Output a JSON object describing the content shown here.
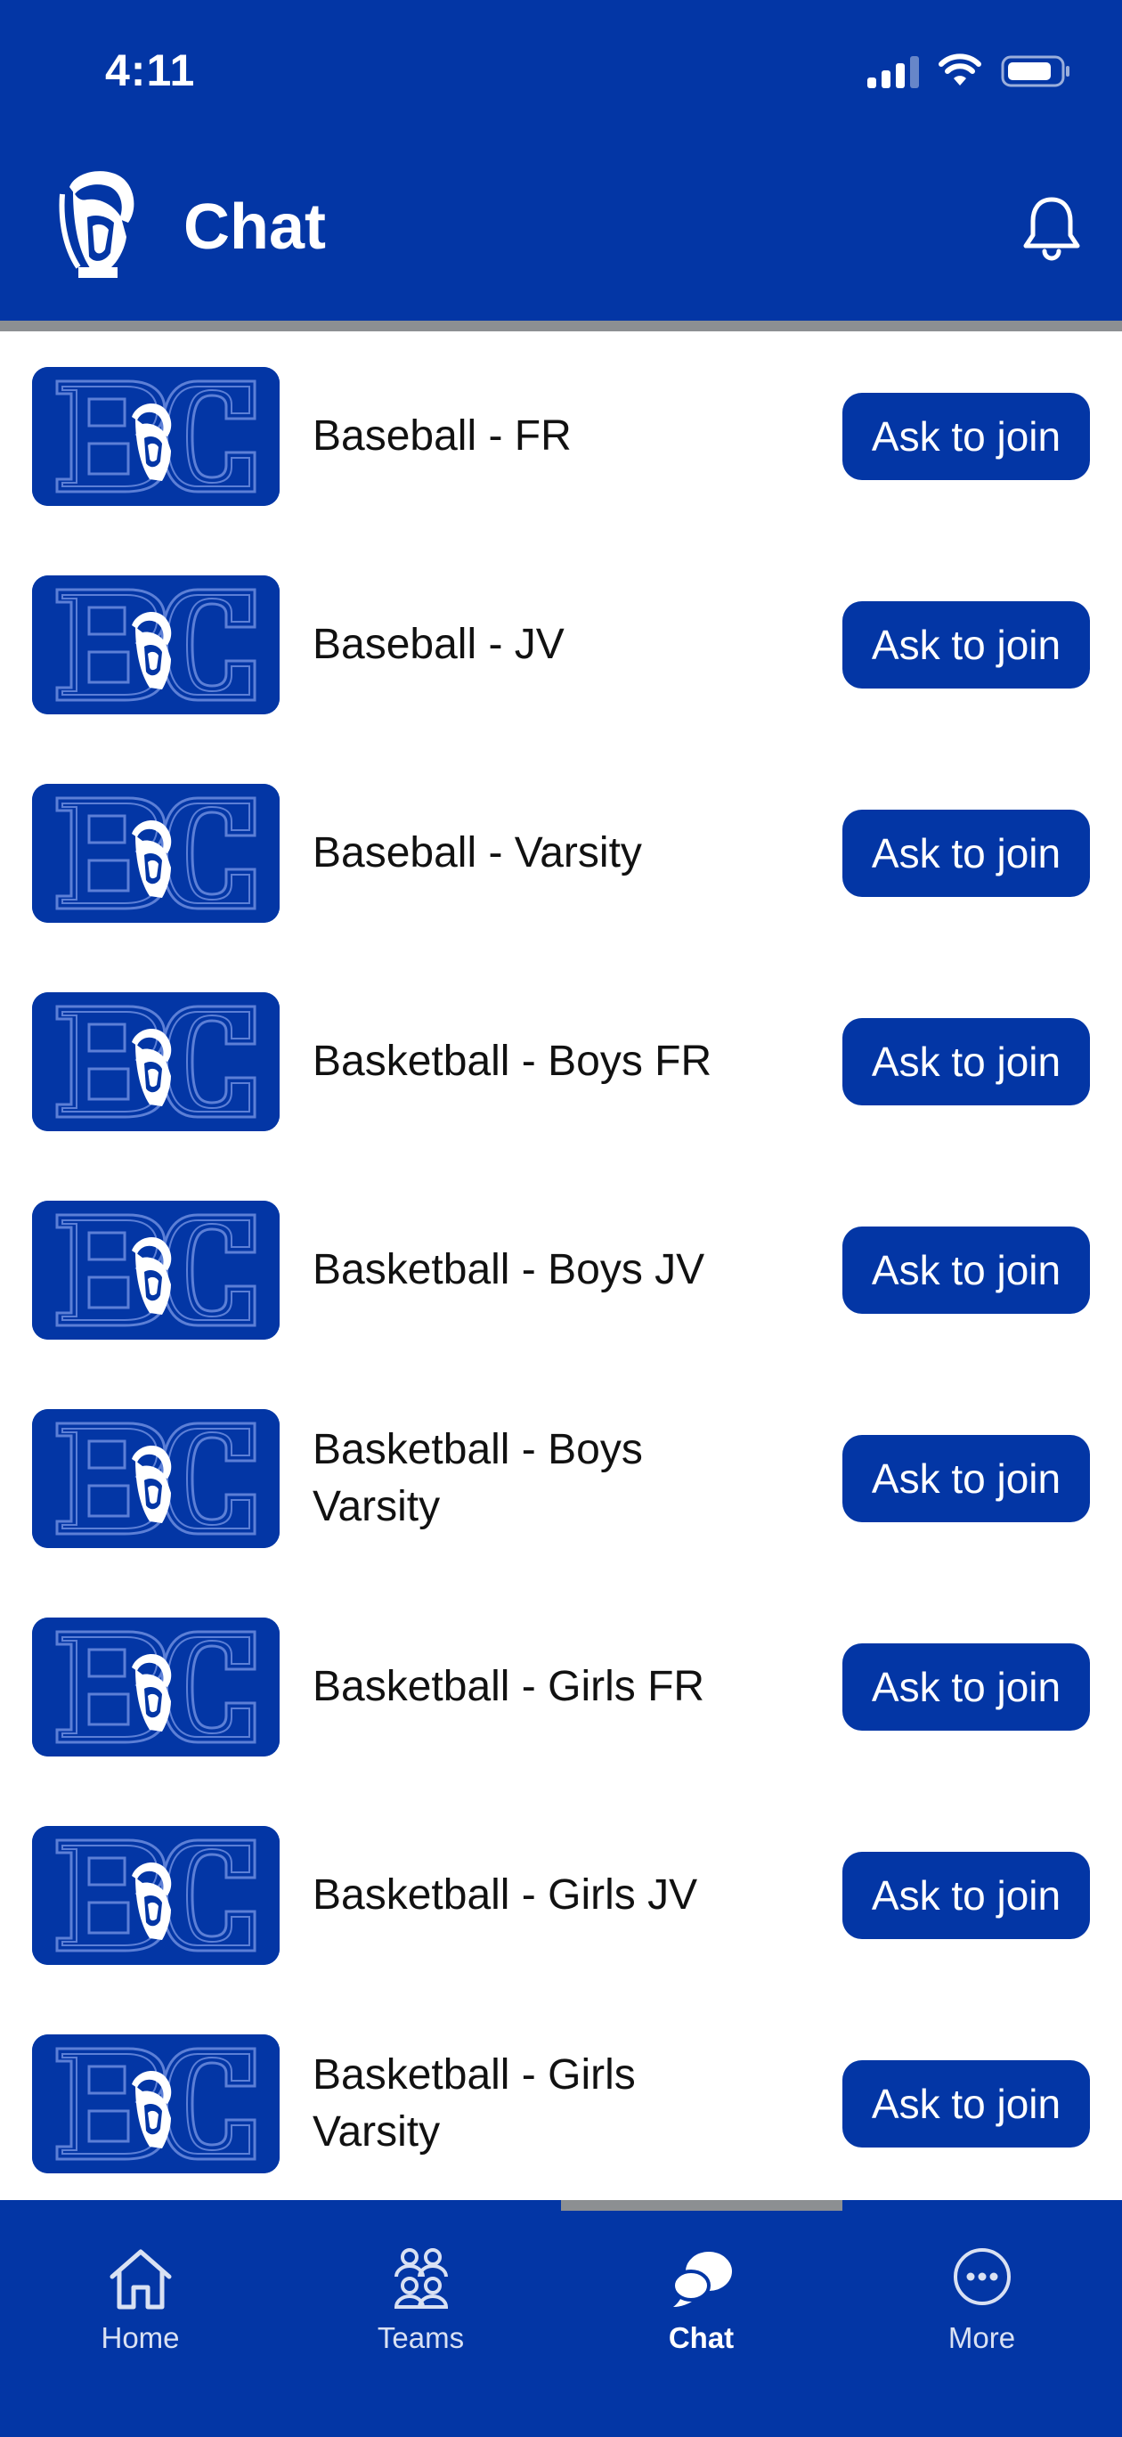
{
  "status_bar": {
    "time": "4:11"
  },
  "header": {
    "title": "Chat",
    "logo_icon": "spartan-helmet-logo",
    "notification_icon": "bell-icon"
  },
  "colors": {
    "brand": "#0336a5",
    "divider": "#8c8f92",
    "text": "#111111"
  },
  "chats": [
    {
      "name": "Baseball - FR",
      "action": "Ask to join"
    },
    {
      "name": "Baseball - JV",
      "action": "Ask to join"
    },
    {
      "name": "Baseball - Varsity",
      "action": "Ask to join"
    },
    {
      "name": "Basketball - Boys FR",
      "action": "Ask to join"
    },
    {
      "name": "Basketball - Boys JV",
      "action": "Ask to join"
    },
    {
      "name": "Basketball - Boys Varsity",
      "action": "Ask to join"
    },
    {
      "name": "Basketball - Girls FR",
      "action": "Ask to join"
    },
    {
      "name": "Basketball - Girls JV",
      "action": "Ask to join"
    },
    {
      "name": "Basketball - Girls Varsity",
      "action": "Ask to join"
    }
  ],
  "bottom_nav": [
    {
      "label": "Home",
      "icon": "home-icon"
    },
    {
      "label": "Teams",
      "icon": "teams-icon"
    },
    {
      "label": "Chat",
      "icon": "chat-icon",
      "active": true
    },
    {
      "label": "More",
      "icon": "more-icon"
    }
  ]
}
